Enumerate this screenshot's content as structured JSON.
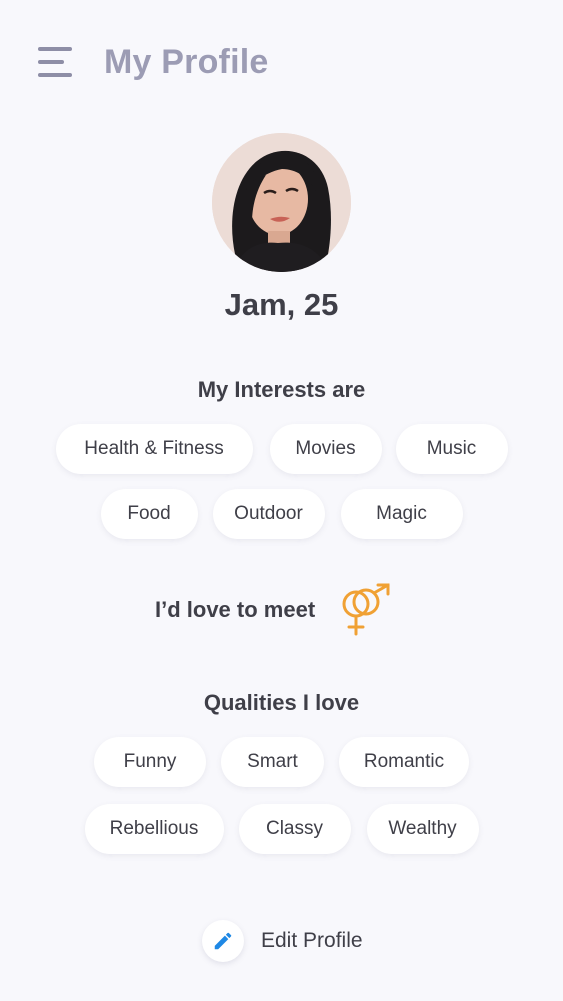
{
  "header": {
    "title": "My Profile",
    "menu_icon": "hamburger-menu-icon"
  },
  "profile": {
    "name_age": "Jam, 25",
    "avatar": "profile-photo"
  },
  "interests": {
    "title": "My Interests are",
    "items": [
      "Health & Fitness",
      "Movies",
      "Music",
      "Food",
      "Outdoor",
      "Magic"
    ]
  },
  "meet": {
    "label": "I’d love to meet",
    "icon": "male-female-gender-icon",
    "icon_color": "#f0a134"
  },
  "qualities": {
    "title": "Qualities I love",
    "items": [
      "Funny",
      "Smart",
      "Romantic",
      "Rebellious",
      "Classy",
      "Wealthy"
    ]
  },
  "edit": {
    "label": "Edit Profile",
    "icon": "pencil-icon",
    "icon_color": "#1e88e5"
  },
  "colors": {
    "background": "#f8f8fc",
    "title": "#9c9cb4",
    "text": "#3f3f48",
    "chip": "#ffffff"
  }
}
